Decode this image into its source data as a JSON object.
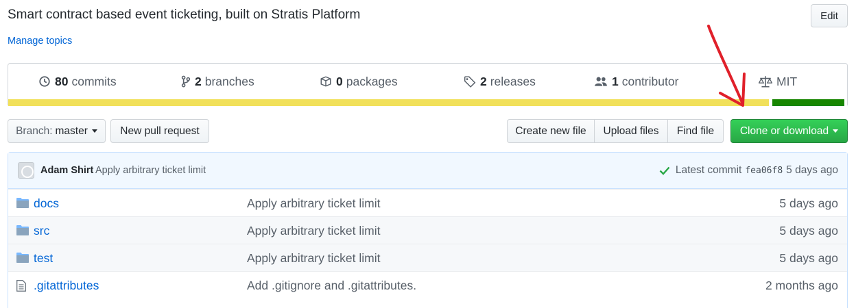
{
  "repo": {
    "description": "Smart contract based event ticketing, built on Stratis Platform",
    "manage_topics": "Manage topics",
    "edit_label": "Edit"
  },
  "summary": {
    "commits": {
      "count": "80",
      "label": "commits",
      "icon": "history-icon"
    },
    "branches": {
      "count": "2",
      "label": "branches",
      "icon": "git-branch-icon"
    },
    "packages": {
      "count": "0",
      "label": "packages",
      "icon": "package-icon"
    },
    "releases": {
      "count": "2",
      "label": "releases",
      "icon": "tag-icon"
    },
    "contributors": {
      "count": "1",
      "label": "contributor",
      "icon": "people-icon"
    },
    "license": {
      "label": "MIT",
      "icon": "law-icon"
    }
  },
  "language_bar": [
    {
      "color": "#f1e05a",
      "fraction": 0.905
    },
    {
      "color": "#ffffff",
      "fraction": 0.004
    },
    {
      "color": "#178600",
      "fraction": 0.086
    }
  ],
  "toolbar": {
    "branch_label": "Branch:",
    "branch_value": "master",
    "new_pr": "New pull request",
    "create_file": "Create new file",
    "upload_files": "Upload files",
    "find_file": "Find file",
    "clone": "Clone or download"
  },
  "latest_commit": {
    "author": "Adam Shirt",
    "message": "Apply arbitrary ticket limit",
    "prefix": "Latest commit",
    "sha": "fea06f8",
    "age": "5 days ago",
    "status_color": "#28a745"
  },
  "files": [
    {
      "type": "dir",
      "name": "docs",
      "message": "Apply arbitrary ticket limit",
      "age": "5 days ago"
    },
    {
      "type": "dir",
      "name": "src",
      "message": "Apply arbitrary ticket limit",
      "age": "5 days ago"
    },
    {
      "type": "dir",
      "name": "test",
      "message": "Apply arbitrary ticket limit",
      "age": "5 days ago"
    },
    {
      "type": "file",
      "name": ".gitattributes",
      "message": "Add .gitignore and .gitattributes.",
      "age": "2 months ago"
    }
  ],
  "colors": {
    "link": "#0366d6",
    "annotation_arrow": "#e0202a",
    "clone_green": "#28a745"
  }
}
